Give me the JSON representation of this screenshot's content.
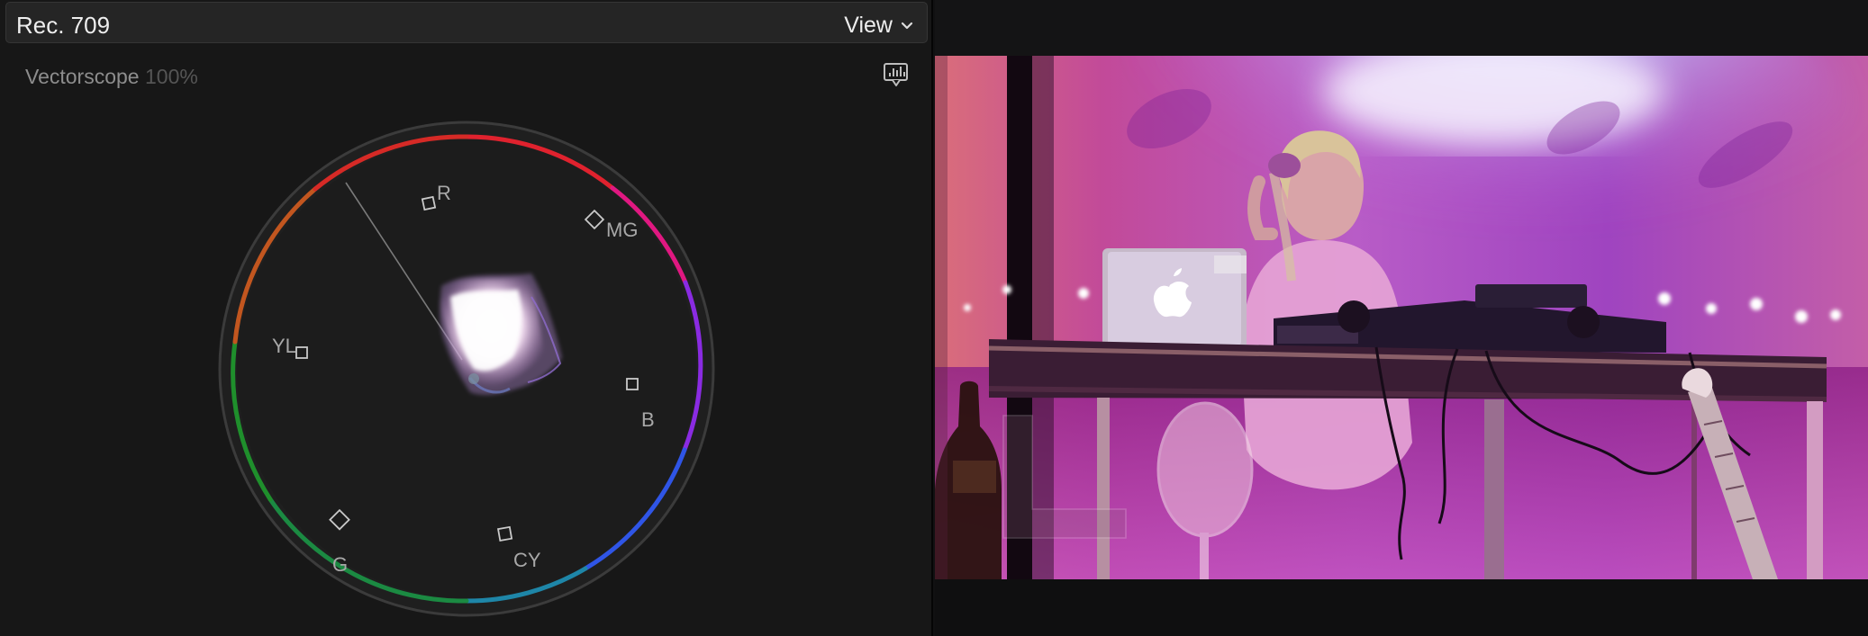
{
  "scope": {
    "title": "Rec. 709",
    "view_menu": "View",
    "label": "Vectorscope",
    "zoom": "100%",
    "targets": {
      "r": "R",
      "mg": "MG",
      "yl": "YL",
      "b": "B",
      "g": "G",
      "cy": "CY"
    }
  },
  "icons": {
    "chevron": "chevron-down-icon",
    "display_options": "scope-display-icon",
    "logo": "apple-logo-icon"
  },
  "colors": {
    "panel_bg": "#171717",
    "header_bg": "#252525",
    "red": "#e0222e",
    "magenta": "#e01881",
    "violet": "#8a2be2",
    "blue": "#2f55e6",
    "cyan": "#1e86a8",
    "green": "#1f8f2c",
    "yellow": "#c2561f",
    "video_tint": "#d34dcb"
  }
}
